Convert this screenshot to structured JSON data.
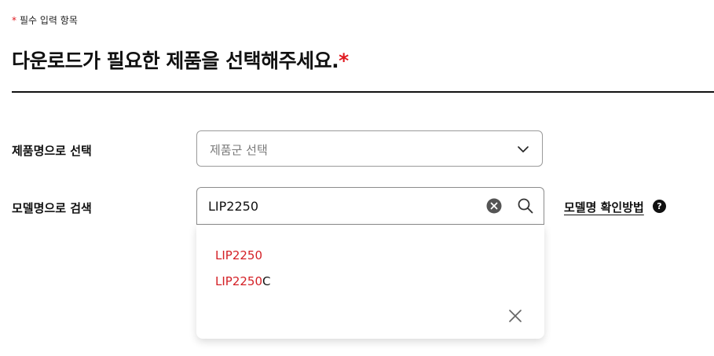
{
  "required_note": {
    "star": "*",
    "text": "필수 입력 항목"
  },
  "title": {
    "text": "다운로드가 필요한 제품을 선택해주세요.",
    "star": "*"
  },
  "product_select": {
    "label": "제품명으로 선택",
    "placeholder": "제품군 선택",
    "icon": "chevron-down-icon"
  },
  "model_search": {
    "label": "모델명으로 검색",
    "value": "LIP2250",
    "clear_icon": "clear-circle-icon",
    "search_icon": "search-icon",
    "help_link": "모델명 확인방법",
    "help_icon": "?"
  },
  "suggestions": {
    "items": [
      {
        "match": "LIP2250",
        "rest": ""
      },
      {
        "match": "LIP2250",
        "rest": "C"
      }
    ],
    "close_icon": "close-icon"
  },
  "colors": {
    "accent": "#e0181f",
    "highlight": "#d42026"
  }
}
